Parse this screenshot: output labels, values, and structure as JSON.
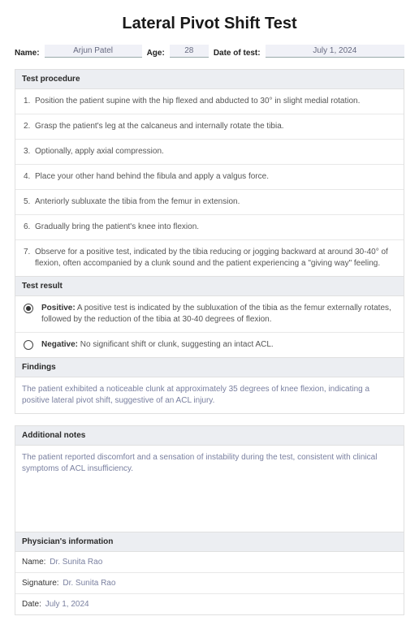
{
  "title": "Lateral Pivot Shift Test",
  "header": {
    "name_label": "Name:",
    "name_value": "Arjun Patel",
    "age_label": "Age:",
    "age_value": "28",
    "date_label": "Date of test:",
    "date_value": "July 1, 2024"
  },
  "procedure": {
    "heading": "Test procedure",
    "steps": [
      "Position the patient supine with the hip flexed and abducted to 30° in slight medial rotation.",
      "Grasp the patient's leg at the calcaneus and internally rotate the tibia.",
      "Optionally, apply axial compression.",
      "Place your other hand behind the fibula and apply a valgus force.",
      "Anteriorly subluxate the tibia from the femur in extension.",
      "Gradually bring the patient's knee into flexion.",
      "Observe for a positive test, indicated by the tibia reducing or jogging backward at around 30-40° of flexion, often accompanied by a clunk sound and the patient experiencing a \"giving way\" feeling."
    ]
  },
  "result": {
    "heading": "Test result",
    "positive_label": "Positive:",
    "positive_desc": " A positive test is indicated by the subluxation of the tibia as the femur externally rotates, followed by the reduction of the tibia at 30-40 degrees of flexion.",
    "negative_label": "Negative:",
    "negative_desc": " No significant shift or clunk, suggesting an intact ACL.",
    "selected": "positive"
  },
  "findings": {
    "heading": "Findings",
    "text": "The patient exhibited a noticeable clunk at approximately 35 degrees of knee flexion, indicating a positive lateral pivot shift, suggestive of an ACL injury."
  },
  "notes": {
    "heading": "Additional notes",
    "text": "The patient reported discomfort and a sensation of instability during the test, consistent with clinical symptoms of ACL insufficiency."
  },
  "physician": {
    "heading": "Physician's information",
    "name_label": "Name:",
    "name_value": "Dr. Sunita Rao",
    "sig_label": "Signature:",
    "sig_value": "Dr. Sunita Rao",
    "date_label": "Date:",
    "date_value": "July 1, 2024"
  }
}
